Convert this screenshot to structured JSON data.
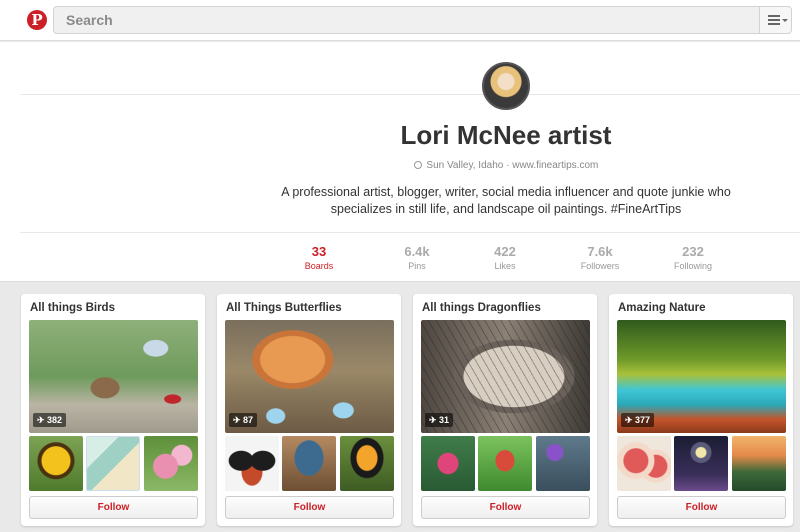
{
  "header": {
    "logo_glyph": "P",
    "search_placeholder": "Search"
  },
  "profile": {
    "name": "Lori McNee artist",
    "location": "Sun Valley, Idaho",
    "separator": "·",
    "website": "www.fineartips.com",
    "bio": "A professional artist, blogger, writer, social media influencer and quote junkie who specializes in still life, and landscape oil paintings. #FineArtTips"
  },
  "stats": [
    {
      "count": "33",
      "label": "Boards",
      "active": true
    },
    {
      "count": "6.4k",
      "label": "Pins"
    },
    {
      "count": "422",
      "label": "Likes"
    },
    {
      "count": "7.6k",
      "label": "Followers"
    },
    {
      "count": "232",
      "label": "Following"
    }
  ],
  "boards": [
    {
      "title": "All things Birds",
      "pin_count": "382",
      "follow_label": "Follow"
    },
    {
      "title": "All Things Butterflies",
      "pin_count": "87",
      "follow_label": "Follow"
    },
    {
      "title": "All things Dragonflies",
      "pin_count": "31",
      "follow_label": "Follow"
    },
    {
      "title": "Amazing Nature",
      "pin_count": "377",
      "follow_label": "Follow"
    }
  ],
  "colors": {
    "brand_red": "#cb2027",
    "page_bg": "#e9e9e9"
  },
  "icons": {
    "logo": "pinterest-logo-icon",
    "menu": "menu-icon",
    "location": "location-icon",
    "pin": "pin-icon"
  }
}
